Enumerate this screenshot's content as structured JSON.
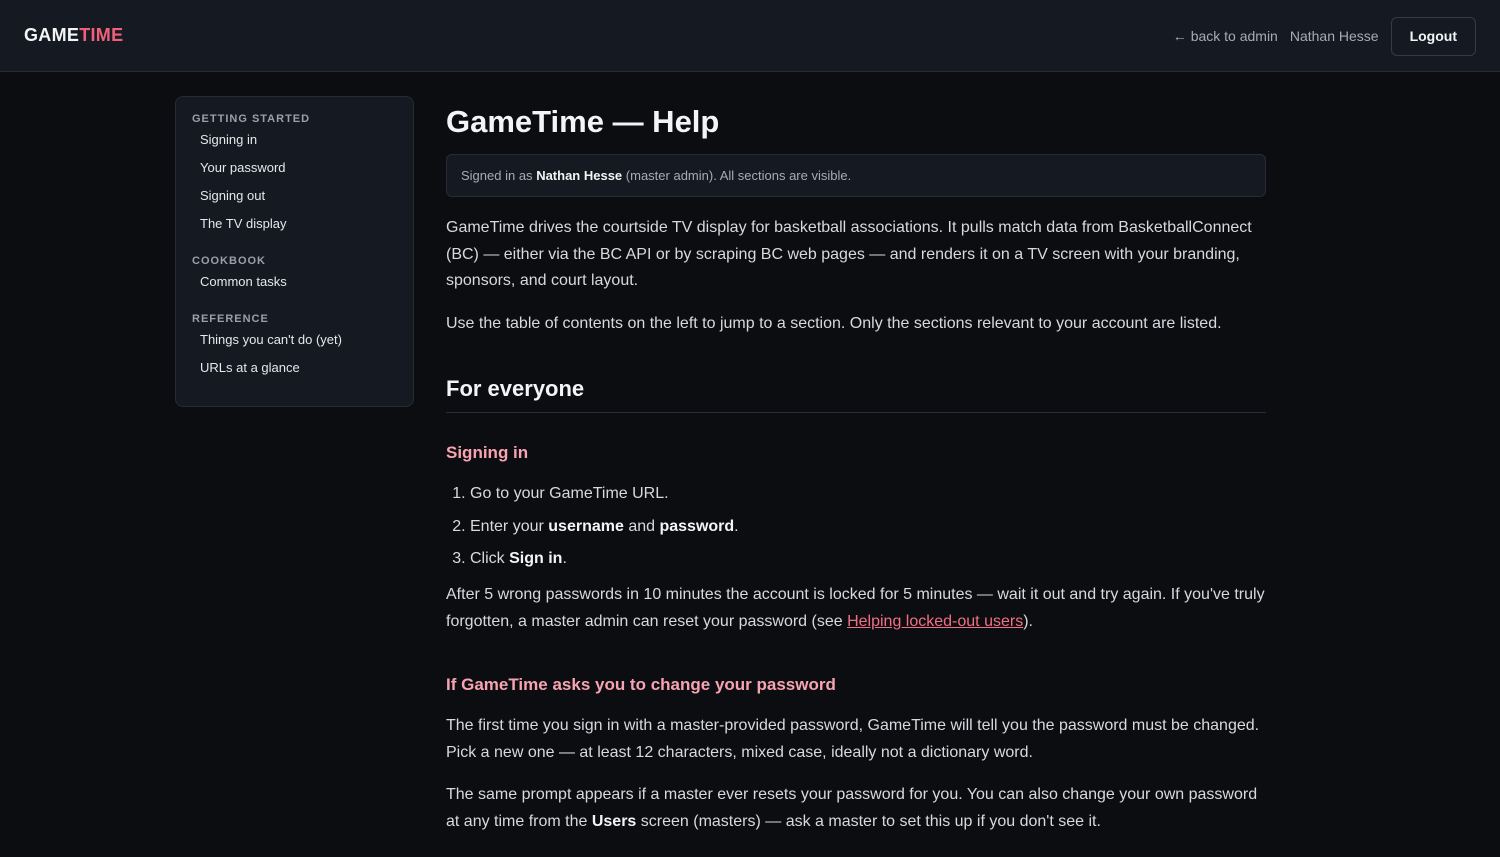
{
  "header": {
    "brand_part1": "GAME",
    "brand_part2": "TIME",
    "back_label": "back to admin",
    "back_icon": "arrow-left-icon",
    "user_name": "Nathan Hesse",
    "logout_label": "Logout"
  },
  "toc": {
    "groups": [
      {
        "heading": "GETTING STARTED",
        "items": [
          "Signing in",
          "Your password",
          "Signing out",
          "The TV display"
        ]
      },
      {
        "heading": "COOKBOOK",
        "items": [
          "Common tasks"
        ]
      },
      {
        "heading": "REFERENCE",
        "items": [
          "Things you can't do (yet)",
          "URLs at a glance"
        ]
      }
    ]
  },
  "main": {
    "title": "GameTime — Help",
    "notice_prefix": "Signed in as",
    "notice_user": "Nathan Hesse",
    "notice_suffix": "(master admin). All sections are visible.",
    "intro1": "GameTime drives the courtside TV display for basketball associations. It pulls match data from BasketballConnect (BC) — either via the BC API or by scraping BC web pages — and renders it on a TV screen with your branding, sponsors, and court layout.",
    "intro2": "Use the table of contents on the left to jump to a section. Only the sections relevant to your account are listed.",
    "section_everyone": "For everyone",
    "signing_in": {
      "title": "Signing in",
      "step1": "Go to your GameTime URL.",
      "step2_a": "Enter your",
      "step2_username": "username",
      "step2_and": "and",
      "step2_password": "password",
      "step2_end": ".",
      "step3_a": "Click",
      "step3_signin": "Sign in",
      "step3_end": ".",
      "lock_text": "After 5 wrong passwords in 10 minutes the account is locked for 5 minutes — wait it out and try again. If you've truly forgotten, a master admin can reset your password (see",
      "lock_link": "Helping locked-out users",
      "lock_end": ")."
    },
    "change_pw": {
      "title": "If GameTime asks you to change your password",
      "para1": "The first time you sign in with a master-provided password, GameTime will tell you the password must be changed. Pick a new one — at least 12 characters, mixed case, ideally not a dictionary word.",
      "para2_a": "The same prompt appears if a master ever resets your password for you. You can also change your own password at any time from the",
      "para2_users": "Users",
      "para2_b": "screen (masters) — ask a master to set this up if you don't see it."
    }
  }
}
